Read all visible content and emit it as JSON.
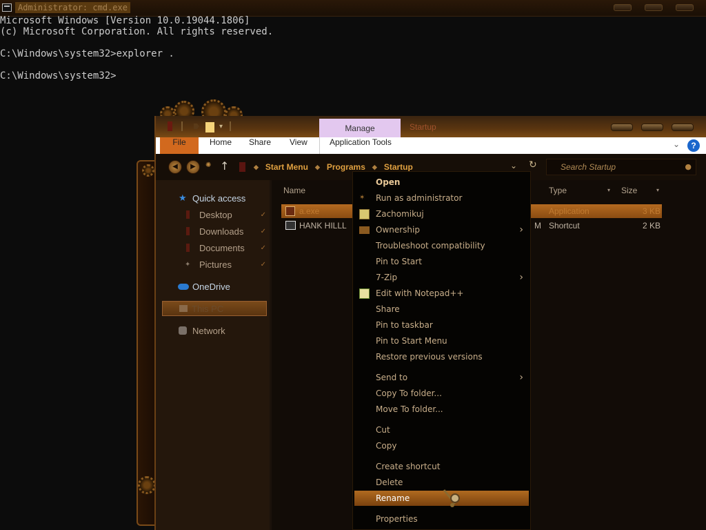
{
  "cmd": {
    "title": "Administrator: cmd.exe",
    "lines": [
      "Microsoft Windows [Version 10.0.19044.1806]",
      "(c) Microsoft Corporation. All rights reserved.",
      "",
      "C:\\Windows\\system32>explorer .",
      "",
      "C:\\Windows\\system32>"
    ]
  },
  "explorer": {
    "title": "Startup",
    "manage_tab": "Manage",
    "ribbon_tabs": [
      "File",
      "Home",
      "Share",
      "View",
      "Application Tools"
    ],
    "help_label": "?",
    "breadcrumb": [
      "Start Menu",
      "Programs",
      "Startup"
    ],
    "search_placeholder": "Search Startup",
    "nav": {
      "quick_access": "Quick access",
      "desktop": "Desktop",
      "downloads": "Downloads",
      "documents": "Documents",
      "pictures": "Pictures",
      "onedrive": "OneDrive",
      "this_pc": "This PC",
      "network": "Network"
    },
    "columns": {
      "name": "Name",
      "type": "Type",
      "size": "Size"
    },
    "files": [
      {
        "name": "a.exe",
        "date_tail": "",
        "type": "Application",
        "size": "3 KB",
        "selected": true
      },
      {
        "name": "HANK HILLL",
        "date_tail": "M",
        "type": "Shortcut",
        "size": "2 KB",
        "selected": false
      }
    ]
  },
  "context_menu": {
    "open": "Open",
    "run_as_admin": "Run as administrator",
    "zachomikuj": "Zachomikuj",
    "ownership": "Ownership",
    "troubleshoot": "Troubleshoot compatibility",
    "pin_to_start": "Pin to Start",
    "seven_zip": "7-Zip",
    "edit_notepadpp": "Edit with Notepad++",
    "share": "Share",
    "pin_to_taskbar": "Pin to taskbar",
    "pin_to_start_menu": "Pin to Start Menu",
    "restore_versions": "Restore previous versions",
    "send_to": "Send to",
    "copy_to_folder": "Copy To folder...",
    "move_to_folder": "Move To folder...",
    "cut": "Cut",
    "copy": "Copy",
    "create_shortcut": "Create shortcut",
    "delete": "Delete",
    "rename": "Rename",
    "properties": "Properties"
  }
}
